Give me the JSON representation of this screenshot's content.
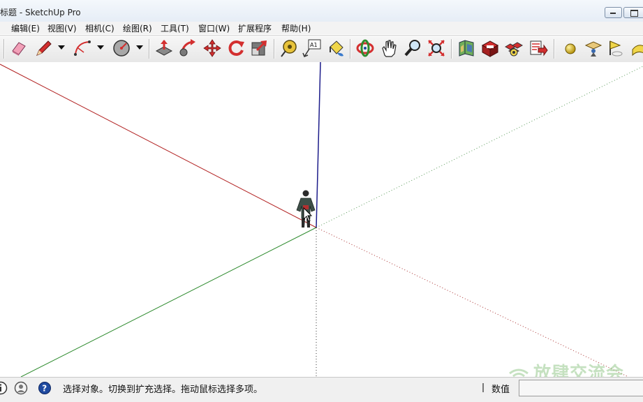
{
  "window": {
    "title": "无标题 - SketchUp Pro",
    "title_visible": "标题 - SketchUp Pro",
    "minimize_label": "",
    "maximize_label": ""
  },
  "menu": {
    "items": [
      {
        "label": "编辑(E)"
      },
      {
        "label": "视图(V)"
      },
      {
        "label": "相机(C)"
      },
      {
        "label": "绘图(R)"
      },
      {
        "label": "工具(T)"
      },
      {
        "label": "窗口(W)"
      },
      {
        "label": "扩展程序"
      },
      {
        "label": "帮助(H)"
      }
    ]
  },
  "toolbar": {
    "tools": [
      {
        "icon": "eraser-icon"
      },
      {
        "icon": "pencil-line-icon"
      },
      {
        "icon": "arc-icon"
      },
      {
        "icon": "circle-icon"
      },
      {
        "icon": "push-pull-icon"
      },
      {
        "icon": "follow-me-icon"
      },
      {
        "icon": "move-icon"
      },
      {
        "icon": "rotate-icon"
      },
      {
        "icon": "scale-icon"
      },
      {
        "icon": "tape-measure-icon"
      },
      {
        "icon": "text-icon",
        "label": "A1"
      },
      {
        "icon": "paint-bucket-icon"
      },
      {
        "icon": "orbit-icon"
      },
      {
        "icon": "pan-icon"
      },
      {
        "icon": "zoom-icon"
      },
      {
        "icon": "zoom-extents-icon"
      },
      {
        "icon": "3d-warehouse-icon"
      },
      {
        "icon": "extension-warehouse-icon"
      },
      {
        "icon": "components-icon"
      },
      {
        "icon": "layout-send-icon"
      },
      {
        "icon": "sphere-icon"
      },
      {
        "icon": "position-camera-icon"
      },
      {
        "icon": "walk-flag-icon"
      },
      {
        "icon": "section-icon"
      }
    ]
  },
  "viewport": {
    "axes": {
      "red": "#b22222",
      "green": "#2e8b2e",
      "blue": "#1c1c8a",
      "dotted": "#5a8a5a"
    },
    "figure": "person-scale-figure-icon",
    "cursor": "arrow-cursor-icon"
  },
  "watermark": {
    "text": "放肆交流会"
  },
  "statusbar": {
    "icons": [
      "info-icon",
      "user-icon",
      "help-icon"
    ],
    "message": "选择对象。切换到扩充选择。拖动鼠标选择多项。",
    "measurement_label": "数值",
    "measurement_value": ""
  }
}
